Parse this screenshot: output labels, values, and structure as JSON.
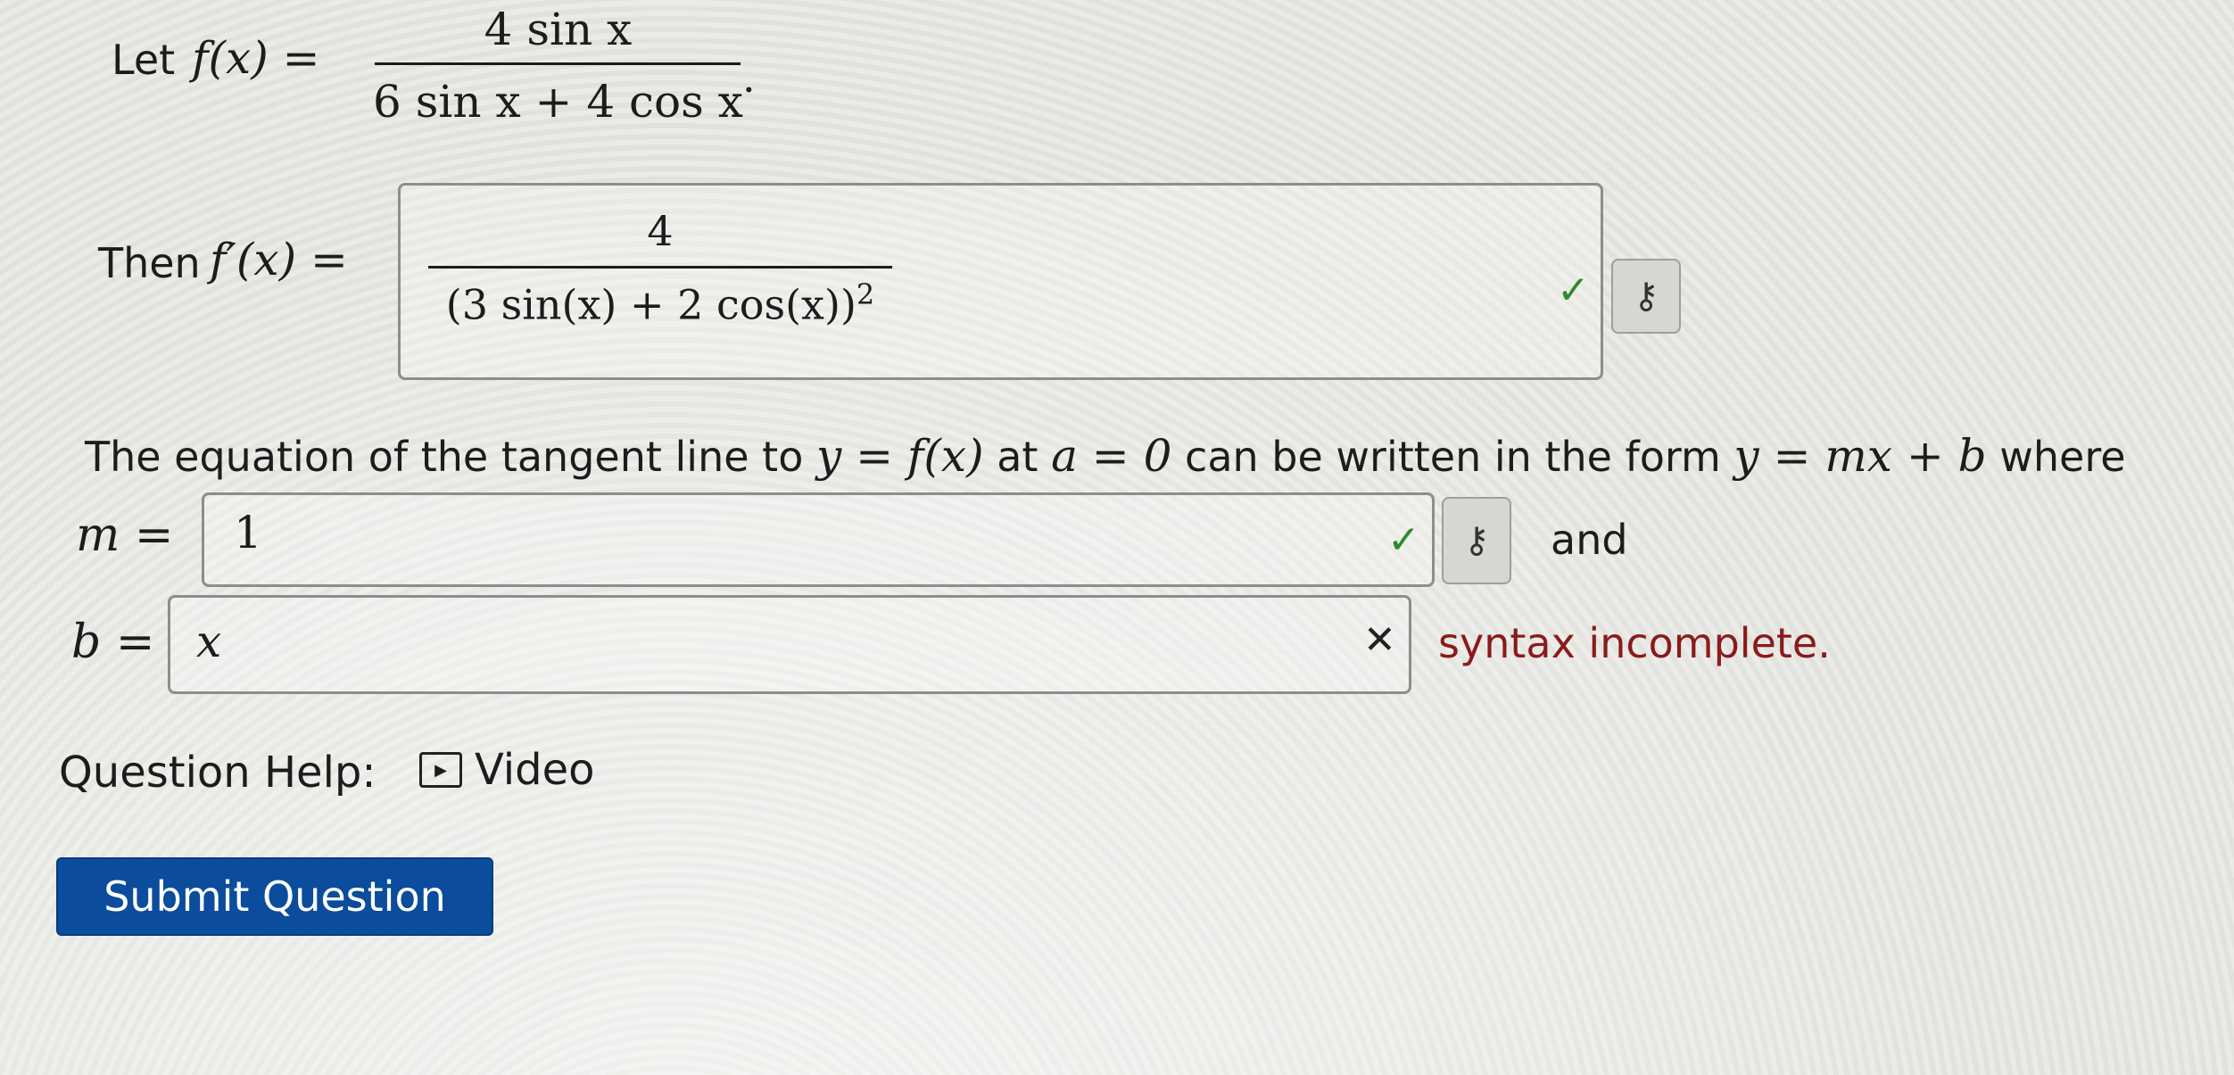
{
  "problem": {
    "let_label": "Let",
    "f_lhs": "f(x) =",
    "f_numerator": "4 sin x",
    "f_denominator": "6 sin x + 4 cos x",
    "period": "."
  },
  "derivative": {
    "then_label": "Then",
    "fprime_lhs": "f′(x) =",
    "answer_numerator": "4",
    "answer_denominator": "(3 sin(x) + 2 cos(x))",
    "answer_exponent": "2",
    "status": "correct"
  },
  "tangent": {
    "sentence_parts": [
      "The equation of the tangent line to ",
      "y = f(x)",
      " at ",
      "a = 0",
      " can be written in the form ",
      "y = mx + b",
      " where"
    ],
    "m_label": "m =",
    "m_value": "1",
    "m_status": "correct",
    "and_label": "and",
    "b_label": "b =",
    "b_value": "x",
    "b_status": "incorrect",
    "b_message": "syntax incomplete."
  },
  "icons": {
    "check": "✓",
    "cross": "✕",
    "key": "⚷",
    "video_play": "▶"
  },
  "help": {
    "label": "Question Help:",
    "video_label": "Video"
  },
  "submit_label": "Submit Question",
  "colors": {
    "correct": "#2f8a2c",
    "error_text": "#8b1a1a",
    "submit_bg": "#0b4c9c"
  }
}
